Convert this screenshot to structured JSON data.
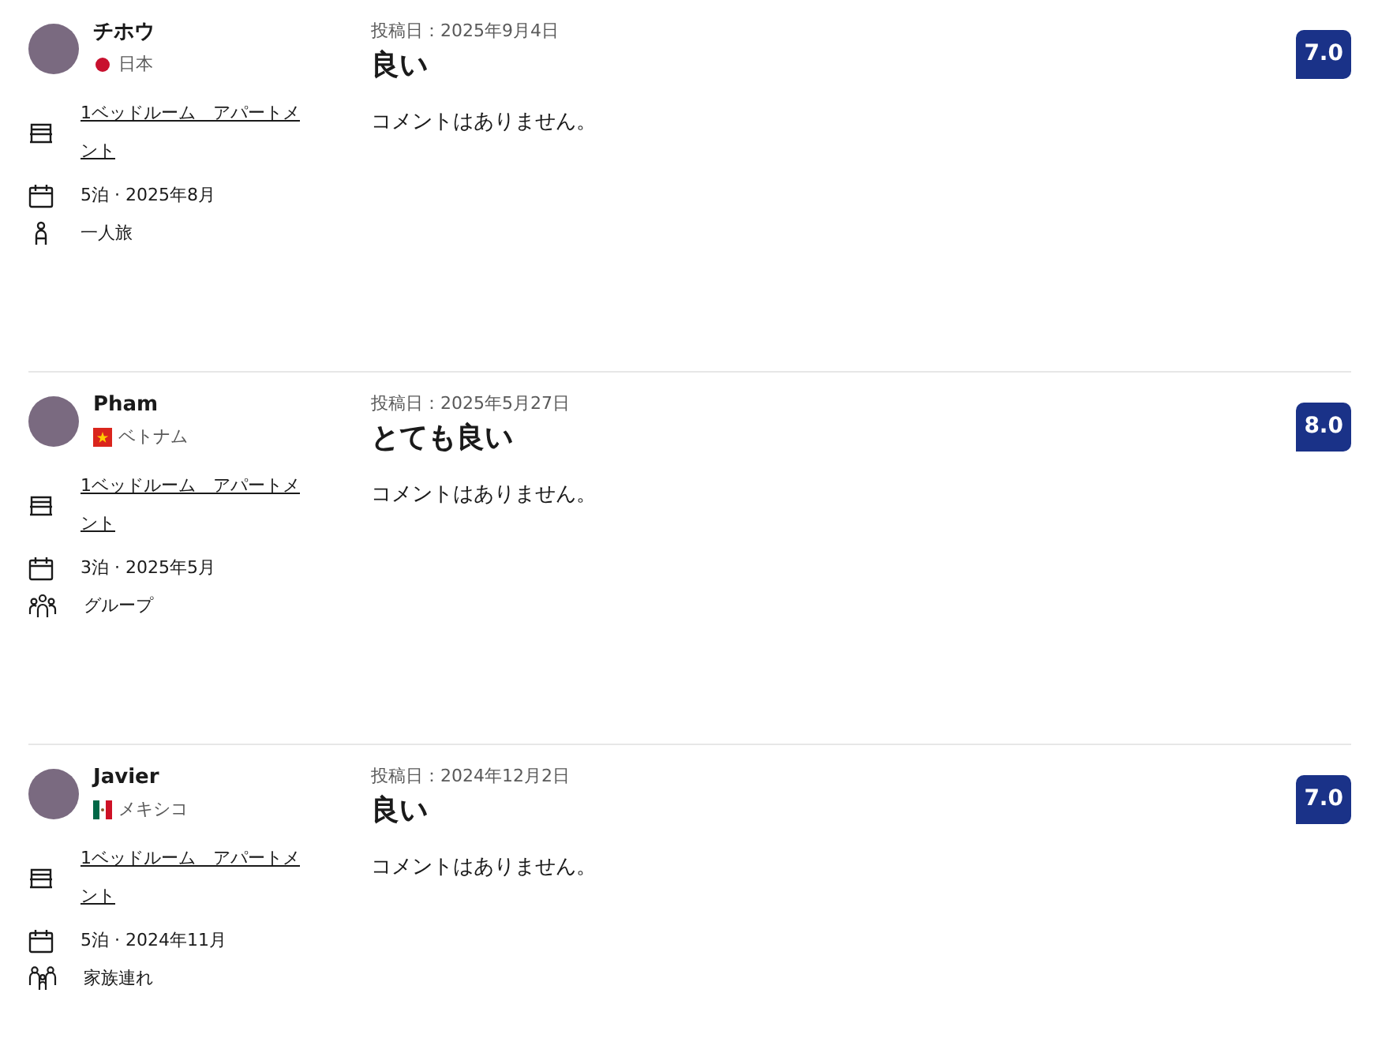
{
  "reviews": [
    {
      "name": "チホウ",
      "country": {
        "kind": "jp",
        "name": "日本"
      },
      "room": "1ベッドルーム　アパートメント",
      "stay": "5泊 · 2025年8月",
      "traveler": {
        "kind": "solo",
        "label": "一人旅"
      },
      "date": "投稿日：2025年9月4日",
      "title": "良い",
      "comment": "コメントはありません。",
      "score": "7.0"
    },
    {
      "name": "Pham",
      "country": {
        "kind": "vn",
        "name": "ベトナム"
      },
      "room": "1ベッドルーム　アパートメント",
      "stay": "3泊 · 2025年5月",
      "traveler": {
        "kind": "group",
        "label": "グループ"
      },
      "date": "投稿日：2025年5月27日",
      "title": "とても良い",
      "comment": "コメントはありません。",
      "score": "8.0"
    },
    {
      "name": "Javier",
      "country": {
        "kind": "mx",
        "name": "メキシコ"
      },
      "room": "1ベッドルーム　アパートメント",
      "stay": "5泊 · 2024年11月",
      "traveler": {
        "kind": "family",
        "label": "家族連れ"
      },
      "date": "投稿日：2024年12月2日",
      "title": "良い",
      "comment": "コメントはありません。",
      "score": "7.0"
    }
  ]
}
